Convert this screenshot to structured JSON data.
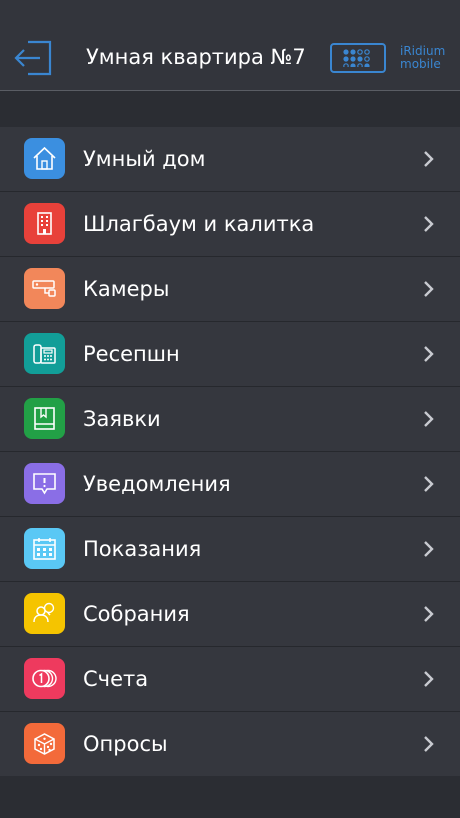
{
  "header": {
    "title": "Умная квартира №7",
    "brand_line1": "iRidium",
    "brand_line2": "mobile",
    "accent_color": "#3a86d1"
  },
  "menu": {
    "items": [
      {
        "label": "Умный дом",
        "icon": "home-icon",
        "color": "#3b8fe0"
      },
      {
        "label": "Шлагбаум и калитка",
        "icon": "building-icon",
        "color": "#e8413a"
      },
      {
        "label": "Камеры",
        "icon": "camera-icon",
        "color": "#f2875a"
      },
      {
        "label": "Ресепшн",
        "icon": "phone-icon",
        "color": "#129e98"
      },
      {
        "label": "Заявки",
        "icon": "book-icon",
        "color": "#22a046"
      },
      {
        "label": "Уведомления",
        "icon": "notification-icon",
        "color": "#8a6ee6"
      },
      {
        "label": "Показания",
        "icon": "calendar-icon",
        "color": "#5ac8f5"
      },
      {
        "label": "Собрания",
        "icon": "people-icon",
        "color": "#f5c400"
      },
      {
        "label": "Счета",
        "icon": "coins-icon",
        "color": "#ee3a5e"
      },
      {
        "label": "Опросы",
        "icon": "dice-icon",
        "color": "#f36a3a"
      }
    ]
  }
}
